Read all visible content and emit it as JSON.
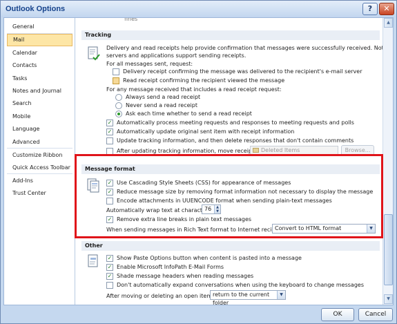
{
  "window": {
    "title": "Outlook Options",
    "help_glyph": "?",
    "close_glyph": "✕"
  },
  "sidebar": {
    "items": [
      {
        "label": "General"
      },
      {
        "label": "Mail"
      },
      {
        "label": "Calendar"
      },
      {
        "label": "Contacts"
      },
      {
        "label": "Tasks"
      },
      {
        "label": "Notes and Journal"
      },
      {
        "label": "Search"
      },
      {
        "label": "Mobile"
      },
      {
        "label": "Language"
      },
      {
        "label": "Advanced"
      },
      {
        "label": "Customize Ribbon"
      },
      {
        "label": "Quick Access Toolbar"
      },
      {
        "label": "Add-Ins"
      },
      {
        "label": "Trust Center"
      }
    ],
    "active_index": 1
  },
  "top_clip": "fines",
  "tracking": {
    "header": "Tracking",
    "intro_line1": "Delivery and read receipts help provide confirmation that messages were successfully received. Not all e-mail",
    "intro_line2": "servers and applications support sending receipts.",
    "for_all_sent": "For all messages sent, request:",
    "delivery_receipt": "Delivery receipt confirming the message was delivered to the recipient's e-mail server",
    "read_receipt": "Read receipt confirming the recipient viewed the message",
    "for_any_received": "For any message received that includes a read receipt request:",
    "always_send": "Always send a read receipt",
    "never_send": "Never send a read receipt",
    "ask_each": "Ask each time whether to send a read receipt",
    "auto_process": "Automatically process meeting requests and responses to meeting requests and polls",
    "auto_update": "Automatically update original sent item with receipt information",
    "update_tracking": "Update tracking information, and then delete responses that don't contain comments",
    "after_updating": "After updating tracking information, move receipt to:",
    "deleted_items": "Deleted Items",
    "browse": "Browse..."
  },
  "message_format": {
    "header": "Message format",
    "use_css": "Use Cascading Style Sheets (CSS) for appearance of messages",
    "reduce_size": "Reduce message size by removing format information not necessary to display the message",
    "encode_attach": "Encode attachments in UUENCODE format when sending plain-text messages",
    "wrap_label": "Automatically wrap text at character:",
    "wrap_value": "76",
    "remove_breaks": "Remove extra line breaks in plain text messages",
    "rtf_label": "When sending messages in Rich Text format to Internet recipients:",
    "rtf_value": "Convert to HTML format"
  },
  "other": {
    "header": "Other",
    "paste_options": "Show Paste Options button when content is pasted into a message",
    "infopath": "Enable Microsoft InfoPath E-Mail Forms",
    "shade_headers": "Shade message headers when reading messages",
    "dont_expand": "Don't automatically expand conversations when using the keyboard to change messages",
    "after_moving": "After moving or deleting an open item:",
    "after_moving_value": "return to the current folder"
  },
  "footer": {
    "ok": "OK",
    "cancel": "Cancel"
  },
  "colors": {
    "highlight_border": "#e0141a",
    "active_item": "#fde6a6",
    "check": "#1f7a1f"
  }
}
